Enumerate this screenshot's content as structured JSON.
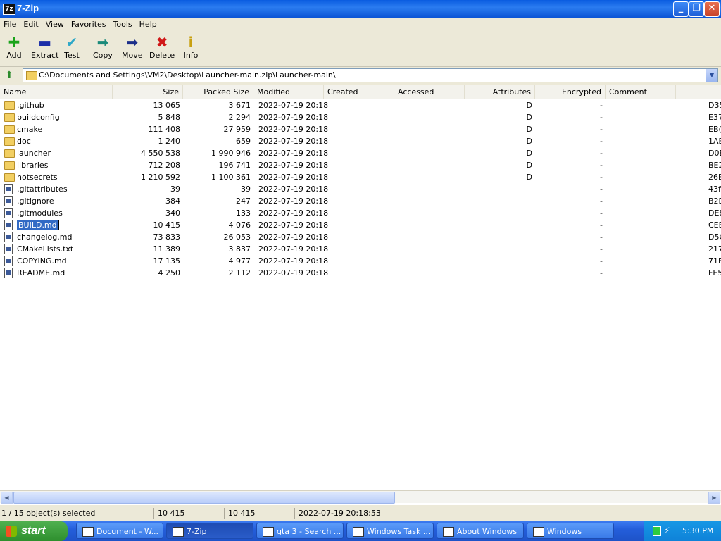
{
  "window": {
    "title": "7-Zip",
    "app_icon": "7z"
  },
  "menu": [
    "File",
    "Edit",
    "View",
    "Favorites",
    "Tools",
    "Help"
  ],
  "toolbar": [
    {
      "label": "Add",
      "icon": "add-plus-icon",
      "glyph": "✚",
      "color": "#1aa31a"
    },
    {
      "label": "Extract",
      "icon": "extract-minus-icon",
      "glyph": "▬",
      "color": "#1c2fa8"
    },
    {
      "label": "Test",
      "icon": "test-check-icon",
      "glyph": "✔",
      "color": "#2ea8c8"
    },
    {
      "label": "Copy",
      "icon": "copy-arrow-icon",
      "glyph": "➡",
      "color": "#1a8a7a"
    },
    {
      "label": "Move",
      "icon": "move-arrow-icon",
      "glyph": "➡",
      "color": "#1c2f8a"
    },
    {
      "label": "Delete",
      "icon": "delete-x-icon",
      "glyph": "✖",
      "color": "#d01818"
    },
    {
      "label": "Info",
      "icon": "info-icon",
      "glyph": "i",
      "color": "#c8a010"
    }
  ],
  "address": {
    "path": "C:\\Documents and Settings\\VM2\\Desktop\\Launcher-main.zip\\Launcher-main\\"
  },
  "columns": [
    "Name",
    "Size",
    "Packed Size",
    "Modified",
    "Created",
    "Accessed",
    "Attributes",
    "Encrypted",
    "Comment"
  ],
  "files": [
    {
      "type": "folder",
      "name": ".github",
      "size": "13 065",
      "packed": "3 671",
      "modified": "2022-07-19 20:18",
      "attr": "D",
      "enc": "-",
      "crc": "D35"
    },
    {
      "type": "folder",
      "name": "buildconfig",
      "size": "5 848",
      "packed": "2 294",
      "modified": "2022-07-19 20:18",
      "attr": "D",
      "enc": "-",
      "crc": "E37"
    },
    {
      "type": "folder",
      "name": "cmake",
      "size": "111 408",
      "packed": "27 959",
      "modified": "2022-07-19 20:18",
      "attr": "D",
      "enc": "-",
      "crc": "EB("
    },
    {
      "type": "folder",
      "name": "doc",
      "size": "1 240",
      "packed": "659",
      "modified": "2022-07-19 20:18",
      "attr": "D",
      "enc": "-",
      "crc": "1AE"
    },
    {
      "type": "folder",
      "name": "launcher",
      "size": "4 550 538",
      "packed": "1 990 946",
      "modified": "2022-07-19 20:18",
      "attr": "D",
      "enc": "-",
      "crc": "D0E"
    },
    {
      "type": "folder",
      "name": "libraries",
      "size": "712 208",
      "packed": "196 741",
      "modified": "2022-07-19 20:18",
      "attr": "D",
      "enc": "-",
      "crc": "BE2"
    },
    {
      "type": "folder",
      "name": "notsecrets",
      "size": "1 210 592",
      "packed": "1 100 361",
      "modified": "2022-07-19 20:18",
      "attr": "D",
      "enc": "-",
      "crc": "26E"
    },
    {
      "type": "file",
      "name": ".gitattributes",
      "size": "39",
      "packed": "39",
      "modified": "2022-07-19 20:18",
      "attr": "",
      "enc": "-",
      "crc": "43f"
    },
    {
      "type": "file",
      "name": ".gitignore",
      "size": "384",
      "packed": "247",
      "modified": "2022-07-19 20:18",
      "attr": "",
      "enc": "-",
      "crc": "B2D"
    },
    {
      "type": "file",
      "name": ".gitmodules",
      "size": "340",
      "packed": "133",
      "modified": "2022-07-19 20:18",
      "attr": "",
      "enc": "-",
      "crc": "DE8"
    },
    {
      "type": "file",
      "name": "BUILD.md",
      "size": "10 415",
      "packed": "4 076",
      "modified": "2022-07-19 20:18",
      "attr": "",
      "enc": "-",
      "crc": "CEE",
      "selected": true
    },
    {
      "type": "file",
      "name": "changelog.md",
      "size": "73 833",
      "packed": "26 053",
      "modified": "2022-07-19 20:18",
      "attr": "",
      "enc": "-",
      "crc": "D5C"
    },
    {
      "type": "file",
      "name": "CMakeLists.txt",
      "size": "11 389",
      "packed": "3 837",
      "modified": "2022-07-19 20:18",
      "attr": "",
      "enc": "-",
      "crc": "217"
    },
    {
      "type": "file",
      "name": "COPYING.md",
      "size": "17 135",
      "packed": "4 977",
      "modified": "2022-07-19 20:18",
      "attr": "",
      "enc": "-",
      "crc": "71E"
    },
    {
      "type": "file",
      "name": "README.md",
      "size": "4 250",
      "packed": "2 112",
      "modified": "2022-07-19 20:18",
      "attr": "",
      "enc": "-",
      "crc": "FE5"
    }
  ],
  "status": {
    "selected": "1 / 15 object(s) selected",
    "size": "10 415",
    "packed": "10 415",
    "modified": "2022-07-19 20:18:53"
  },
  "taskbar": {
    "start": "start",
    "buttons": [
      {
        "label": "Document - W...",
        "icon": "word-doc-icon"
      },
      {
        "label": "7-Zip",
        "icon": "7zip-icon",
        "active": true
      },
      {
        "label": "gta 3 - Search ...",
        "icon": "ie-icon"
      },
      {
        "label": "Windows Task ...",
        "icon": "task-manager-icon"
      },
      {
        "label": "About Windows",
        "icon": "window-icon"
      },
      {
        "label": "Windows",
        "icon": "window-icon"
      }
    ],
    "clock": "5:30 PM"
  }
}
